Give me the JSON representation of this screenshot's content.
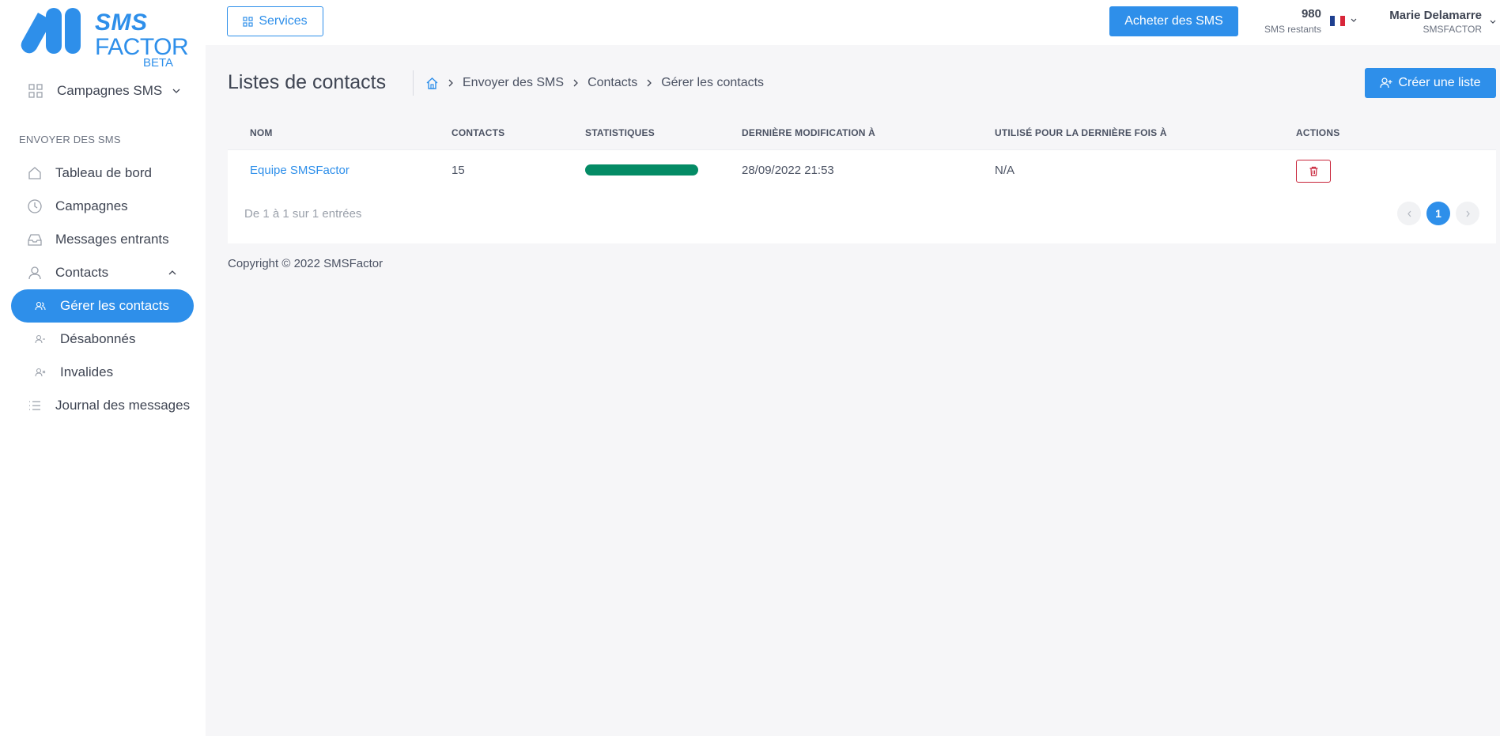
{
  "logo": {
    "line1": "SMS",
    "line2": "FACTOR",
    "badge": "BETA"
  },
  "sidebar": {
    "campaigns_menu": "Campagnes SMS",
    "section": "ENVOYER DES SMS",
    "items": [
      {
        "label": "Tableau de bord",
        "icon": "home-icon"
      },
      {
        "label": "Campagnes",
        "icon": "clock-icon"
      },
      {
        "label": "Messages entrants",
        "icon": "inbox-icon"
      },
      {
        "label": "Contacts",
        "icon": "user-icon"
      }
    ],
    "contacts_sub": [
      {
        "label": "Gérer les contacts",
        "active": true
      },
      {
        "label": "Désabonnés",
        "active": false
      },
      {
        "label": "Invalides",
        "active": false
      }
    ],
    "log": "Journal des messages"
  },
  "header": {
    "services": "Services",
    "buy": "Acheter des SMS",
    "credits": "980",
    "credits_label": "SMS restants",
    "user_name": "Marie Delamarre",
    "user_org": "SMSFACTOR"
  },
  "page": {
    "title": "Listes de contacts",
    "breadcrumb": [
      "Envoyer des SMS",
      "Contacts",
      "Gérer les contacts"
    ],
    "create": "Créer une liste"
  },
  "table": {
    "headers": [
      "NOM",
      "CONTACTS",
      "STATISTIQUES",
      "DERNIÈRE MODIFICATION À",
      "UTILISÉ POUR LA DERNIÈRE FOIS À",
      "ACTIONS"
    ],
    "rows": [
      {
        "name": "Equipe SMSFactor",
        "contacts": "15",
        "stat_percent": 100,
        "modified": "28/09/2022 21:53",
        "last_used": "N/A"
      }
    ],
    "entries_info": "De 1 à 1 sur 1 entrées",
    "current_page": "1"
  },
  "footer": {
    "copyright": "Copyright © 2022 SMSFactor"
  },
  "colors": {
    "accent": "#2e8fea",
    "stat": "#048b65",
    "danger": "#c8243a"
  }
}
